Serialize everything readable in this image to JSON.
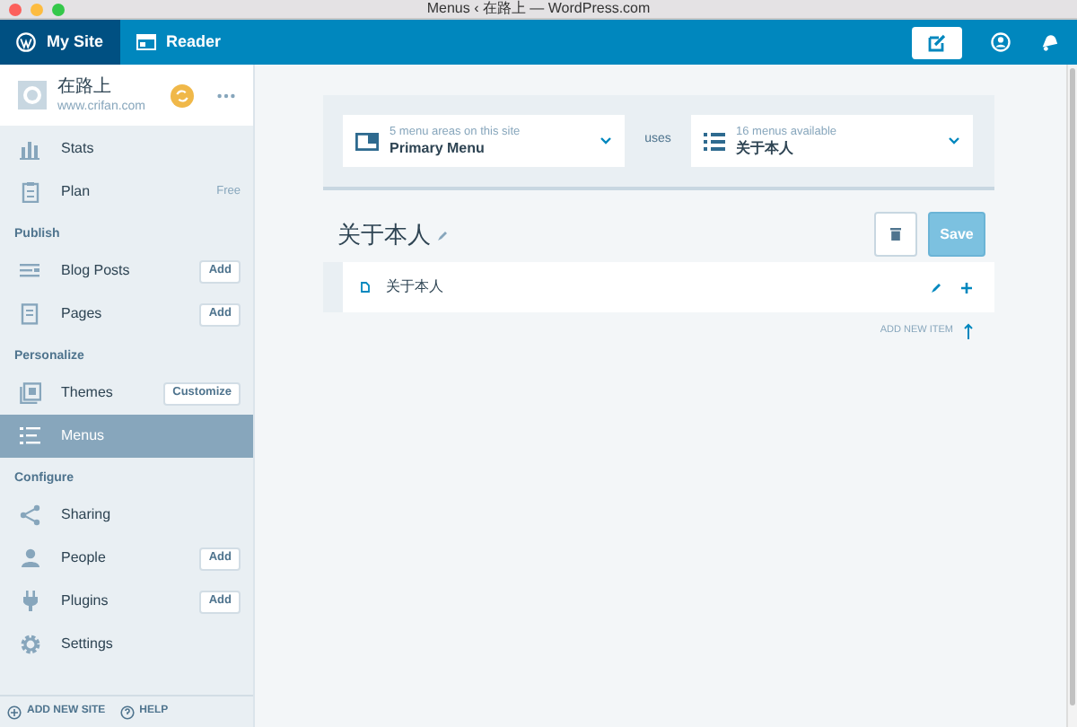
{
  "window": {
    "title": "Menus ‹ 在路上 — WordPress.com"
  },
  "top_bar": {
    "tabs": [
      {
        "label": "My Site",
        "selected": true
      },
      {
        "label": "Reader",
        "selected": false
      }
    ]
  },
  "site": {
    "name": "在路上",
    "url": "www.crifan.com"
  },
  "sidebar": {
    "sections": [
      {
        "items": [
          {
            "label": "Stats",
            "selected": false
          },
          {
            "label": "Plan",
            "badge": "Free",
            "selected": false
          }
        ]
      },
      {
        "heading": "Publish",
        "items": [
          {
            "label": "Blog Posts",
            "action": "Add",
            "selected": false
          },
          {
            "label": "Pages",
            "action": "Add",
            "selected": false
          }
        ]
      },
      {
        "heading": "Personalize",
        "items": [
          {
            "label": "Themes",
            "action": "Customize",
            "selected": false
          },
          {
            "label": "Menus",
            "selected": true
          }
        ]
      },
      {
        "heading": "Configure",
        "items": [
          {
            "label": "Sharing",
            "selected": false
          },
          {
            "label": "People",
            "action": "Add",
            "selected": false
          },
          {
            "label": "Plugins",
            "action": "Add",
            "selected": false
          },
          {
            "label": "Settings",
            "selected": false
          }
        ]
      }
    ],
    "footer": [
      "ADD NEW SITE",
      "HELP"
    ]
  },
  "location": {
    "hint": "5 menu areas on this site",
    "value": "Primary Menu"
  },
  "connector": "uses",
  "menu_picker": {
    "hint": "16 menus available",
    "value": "关于本人"
  },
  "menu": {
    "title": "关于本人",
    "save": "Save",
    "save_disabled": true,
    "items": [
      {
        "label": "关于本人"
      }
    ],
    "add_new": "ADD NEW ITEM"
  }
}
